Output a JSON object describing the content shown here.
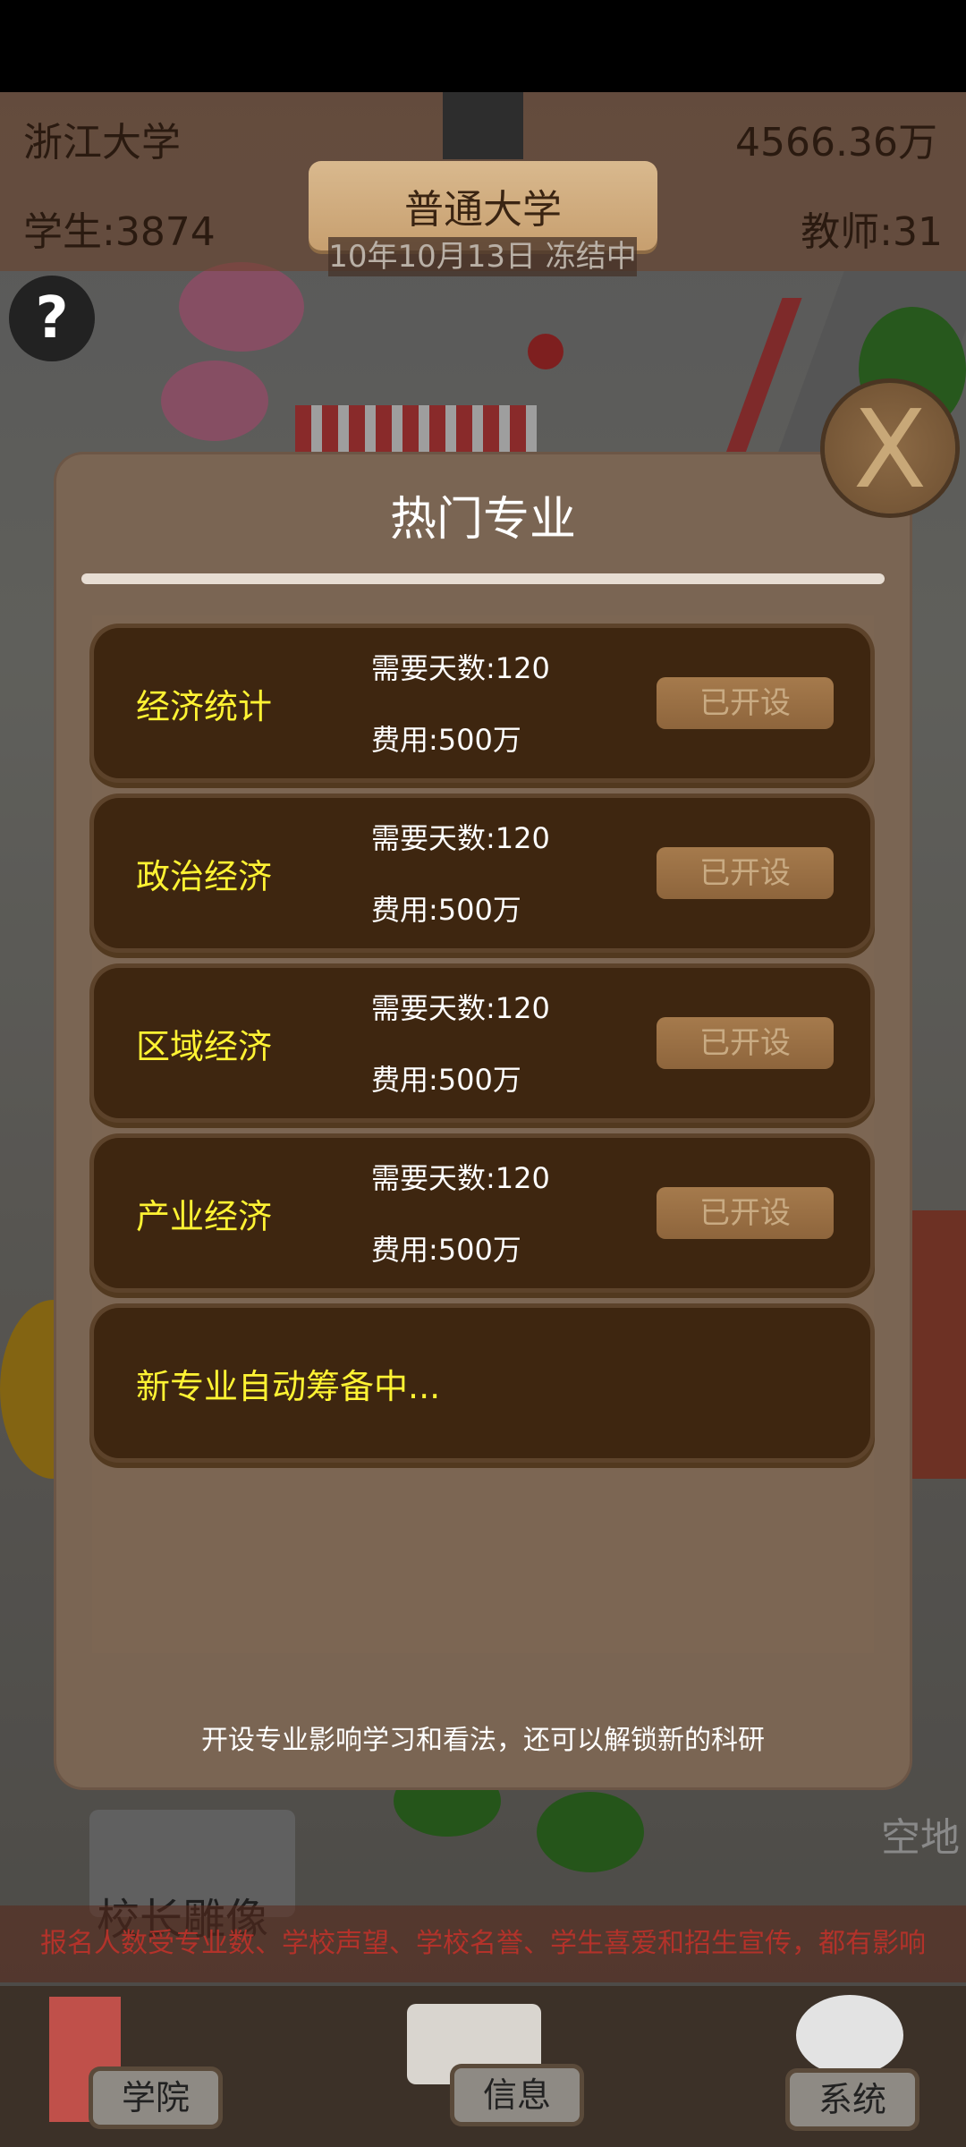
{
  "hud": {
    "school_name": "浙江大学",
    "funds": "4566.36万",
    "students": "学生:3874",
    "teachers": "教师:31",
    "school_tier": "普通大学",
    "date_status": "10年10月13日 冻结中"
  },
  "help_button": "?",
  "modal": {
    "title": "热门专业",
    "majors": [
      {
        "name": "经济统计",
        "days": "需要天数:120",
        "cost": "费用:500万",
        "status": "已开设"
      },
      {
        "name": "政治经济",
        "days": "需要天数:120",
        "cost": "费用:500万",
        "status": "已开设"
      },
      {
        "name": "区域经济",
        "days": "需要天数:120",
        "cost": "费用:500万",
        "status": "已开设"
      },
      {
        "name": "产业经济",
        "days": "需要天数:120",
        "cost": "费用:500万",
        "status": "已开设"
      }
    ],
    "pending": "新专业自动筹备中...",
    "footer": "开设专业影响学习和看法，还可以解锁新的科研"
  },
  "close_button": "X",
  "map_labels": {
    "statue": "校长雕像",
    "empty_lot": "空地"
  },
  "notice": "报名人数受专业数、学校声望、学校名誉、学生喜爱和招生宣传，都有影响",
  "bottom_nav": {
    "college": "学院",
    "info": "信息",
    "system": "系统"
  }
}
